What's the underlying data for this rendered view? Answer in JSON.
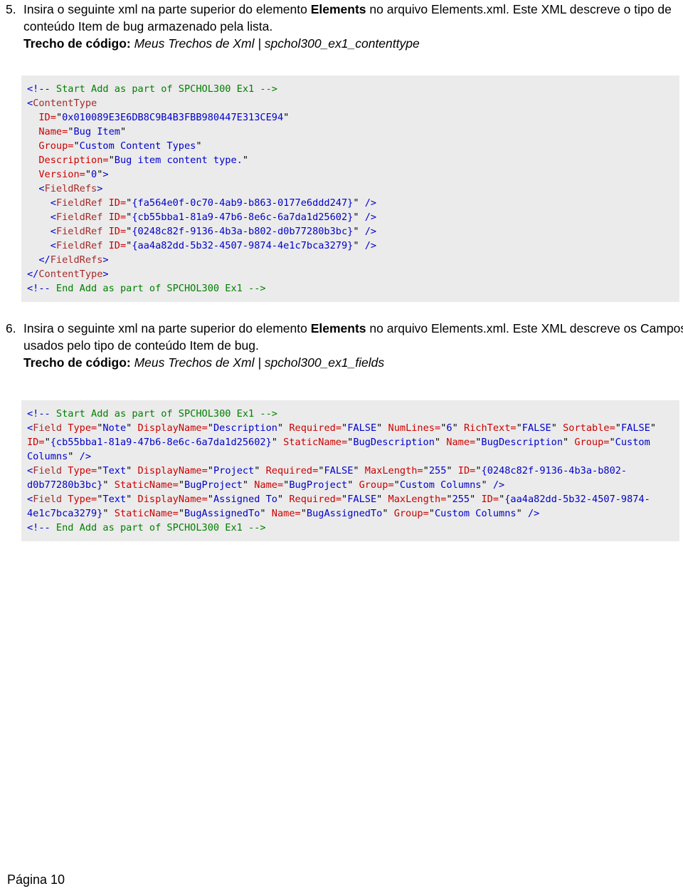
{
  "document": {
    "footer": "Página 10"
  },
  "steps": [
    {
      "number": "5.",
      "text_part1": "Insira o seguinte xml na parte superior do elemento ",
      "bold1": "Elements",
      "text_part2": " no arquivo Elements.xml. Este XML descreve o tipo de conteúdo Item de bug armazenado pela lista.",
      "snippet_label": "Trecho de código",
      "snippet_colon": ": ",
      "snippet_value": "Meus Trechos de Xml | spchol300_ex1_contenttype"
    },
    {
      "number": "6.",
      "text_part1": "Insira o seguinte xml na parte superior do elemento ",
      "bold1": "Elements",
      "text_part2": " no arquivo Elements.xml. Este XML descreve os Campos usados pelo tipo de conteúdo Item de bug.",
      "snippet_label": "Trecho de código",
      "snippet_colon": ": ",
      "snippet_value": "Meus Trechos de Xml | spchol300_ex1_fields"
    }
  ],
  "code_blocks": [
    {
      "id": "contenttype",
      "background": "#ebebeb",
      "lines": [
        "<!-- Start Add as part of SPCHOL300 Ex1 -->",
        "<ContentType",
        "  ID=\"0x010089E3E6DB8C9B4B3FBB980447E313CE94\"",
        "  Name=\"Bug Item\"",
        "  Group=\"Custom Content Types\"",
        "  Description=\"Bug item content type.\"",
        "  Version=\"0\">",
        "  <FieldRefs>",
        "    <FieldRef ID=\"{fa564e0f-0c70-4ab9-b863-0177e6ddd247}\" />",
        "    <FieldRef ID=\"{cb55bba1-81a9-47b6-8e6c-6a7da1d25602}\" />",
        "    <FieldRef ID=\"{0248c82f-9136-4b3a-b802-d0b77280b3bc}\" />",
        "    <FieldRef ID=\"{aa4a82dd-5b32-4507-9874-4e1c7bca3279}\" />",
        "  </FieldRefs>",
        "</ContentType>",
        "<!-- End Add as part of SPCHOL300 Ex1 -->"
      ]
    },
    {
      "id": "fields",
      "background": "#ebebeb",
      "lines": [
        "<!-- Start Add as part of SPCHOL300 Ex1 -->",
        "<Field Type=\"Note\" DisplayName=\"Description\" Required=\"FALSE\" NumLines=\"6\" RichText=\"FALSE\" Sortable=\"FALSE\" ID=\"{cb55bba1-81a9-47b6-8e6c-6a7da1d25602}\" StaticName=\"BugDescription\" Name=\"BugDescription\" Group=\"Custom Columns\" />",
        "<Field Type=\"Text\" DisplayName=\"Project\" Required=\"FALSE\" MaxLength=\"255\" ID=\"{0248c82f-9136-4b3a-b802-d0b77280b3bc}\" StaticName=\"BugProject\" Name=\"BugProject\" Group=\"Custom Columns\" />",
        "<Field Type=\"Text\" DisplayName=\"Assigned To\" Required=\"FALSE\" MaxLength=\"255\" ID=\"{aa4a82dd-5b32-4507-9874-4e1c7bca3279}\" StaticName=\"BugAssignedTo\" Name=\"BugAssignedTo\" Group=\"Custom Columns\" />",
        "<!-- End Add as part of SPCHOL300 Ex1 -->"
      ]
    }
  ],
  "colors": {
    "comment": "#008000",
    "bracket": "#0000cc",
    "tag": "#a52a2a",
    "attribute": "#cc0000",
    "value": "#0000cc",
    "code_background": "#ebebeb"
  }
}
